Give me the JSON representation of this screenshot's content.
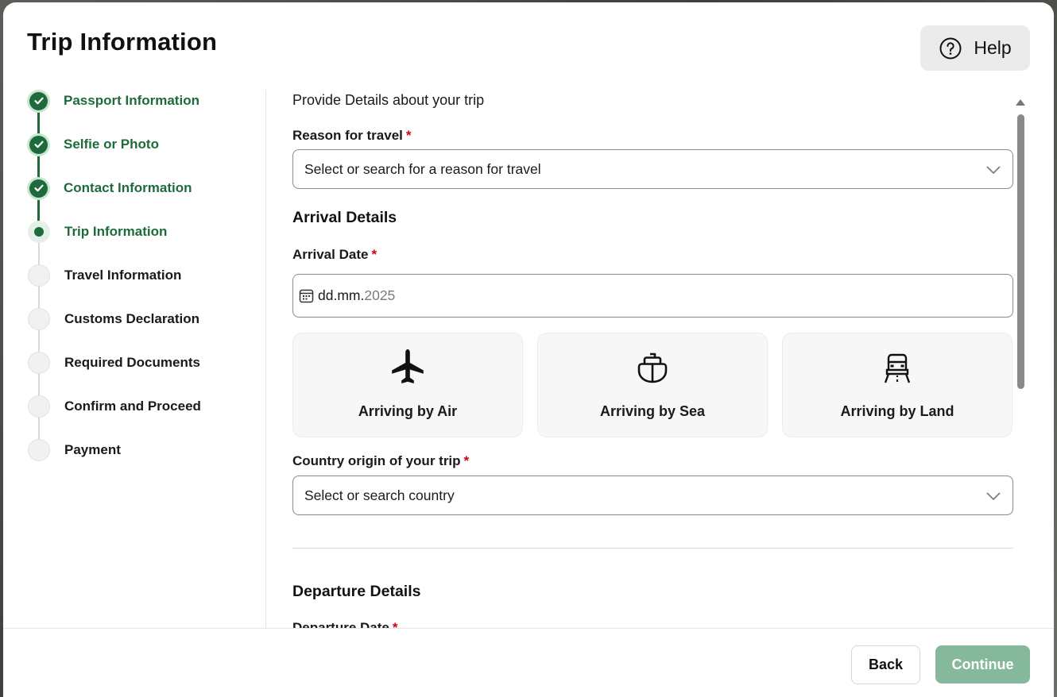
{
  "header": {
    "title": "Trip Information",
    "help_label": "Help"
  },
  "steps": [
    {
      "label": "Passport Information",
      "state": "done"
    },
    {
      "label": "Selfie or Photo",
      "state": "done"
    },
    {
      "label": "Contact Information",
      "state": "done"
    },
    {
      "label": "Trip Information",
      "state": "current"
    },
    {
      "label": "Travel Information",
      "state": "todo"
    },
    {
      "label": "Customs Declaration",
      "state": "todo"
    },
    {
      "label": "Required Documents",
      "state": "todo"
    },
    {
      "label": "Confirm and Proceed",
      "state": "todo"
    },
    {
      "label": "Payment",
      "state": "todo"
    }
  ],
  "form": {
    "intro": "Provide Details about your trip",
    "reason": {
      "label": "Reason for travel",
      "required_mark": "*",
      "placeholder": "Select or search for a reason for travel"
    },
    "arrival": {
      "section_title": "Arrival Details",
      "date_label": "Arrival Date",
      "required_mark": "*",
      "date_day_month": "dd.mm.",
      "date_year": "2025",
      "modes": [
        {
          "label": "Arriving by Air",
          "icon": "airplane-icon"
        },
        {
          "label": "Arriving by Sea",
          "icon": "ship-icon"
        },
        {
          "label": "Arriving by Land",
          "icon": "car-icon"
        }
      ],
      "country_label": "Country origin of your trip",
      "country_placeholder": "Select or search country"
    },
    "departure": {
      "section_title": "Departure Details",
      "date_label": "Departure Date",
      "required_mark": "*"
    }
  },
  "footer": {
    "back_label": "Back",
    "continue_label": "Continue"
  },
  "colors": {
    "accent_green": "#1d6b3b",
    "continue_disabled": "#86b99c",
    "required_red": "#d0021b"
  }
}
